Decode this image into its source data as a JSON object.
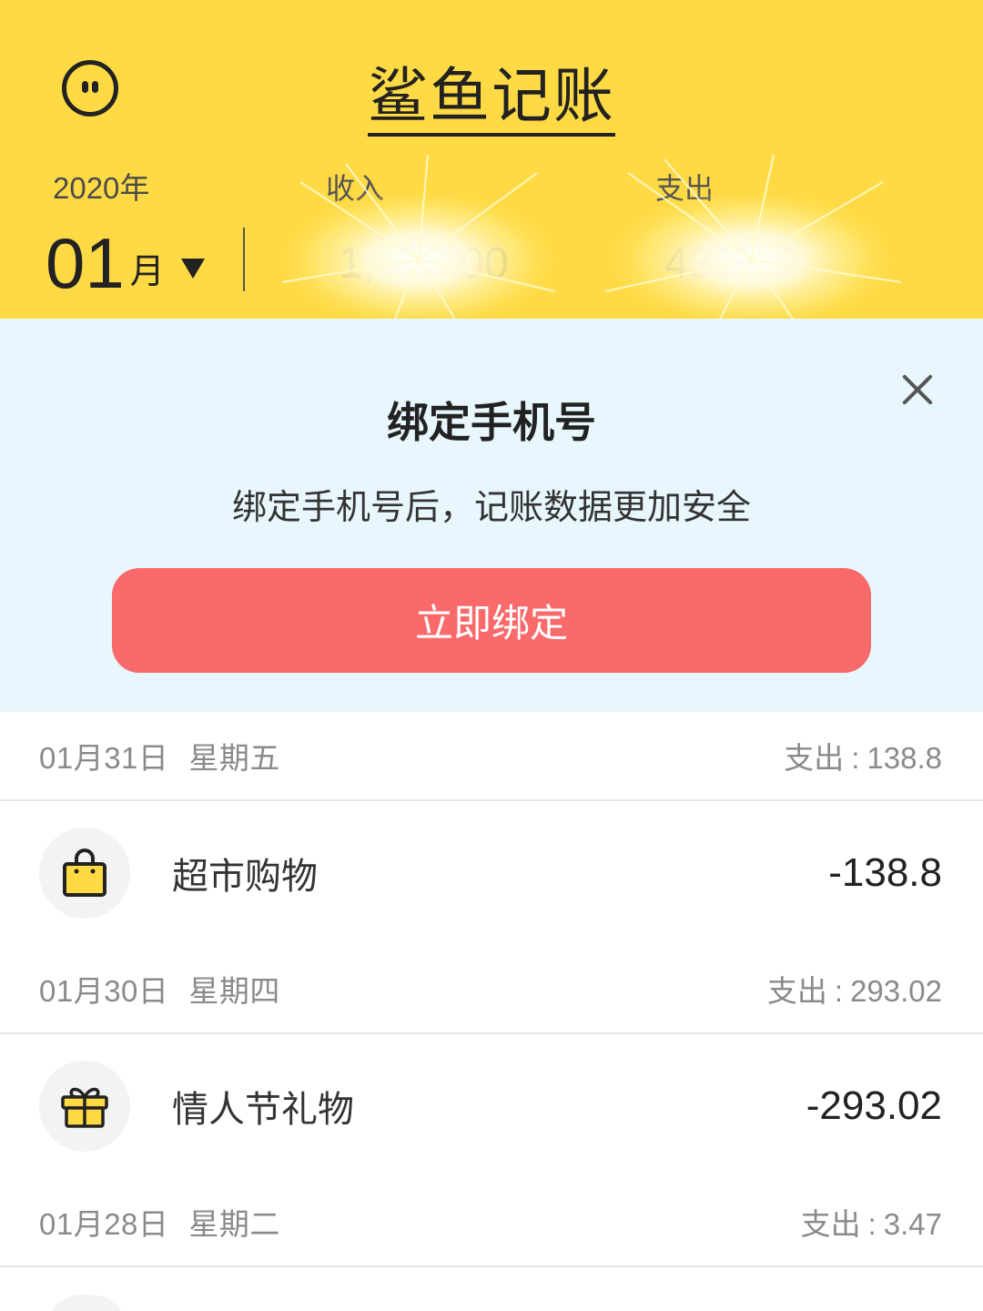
{
  "header": {
    "app_title": "鲨鱼记账",
    "year": "2020年",
    "month_number": "01",
    "month_unit": "月",
    "income_label": "收入",
    "income_value": "1,457.00",
    "expense_label": "支出",
    "expense_value": "432.29",
    "background_color": "#FFDA44"
  },
  "banner": {
    "title": "绑定手机号",
    "description": "绑定手机号后，记账数据更加安全",
    "button_label": "立即绑定",
    "button_color": "#FA6A6B",
    "background_color": "#E8F6FD"
  },
  "days": [
    {
      "date": "01月31日",
      "weekday": "星期五",
      "summary_label": "支出",
      "summary_value": "138.8",
      "records": [
        {
          "icon": "shopping-bag-icon",
          "name": "超市购物",
          "amount": "-138.8"
        }
      ]
    },
    {
      "date": "01月30日",
      "weekday": "星期四",
      "summary_label": "支出",
      "summary_value": "293.02",
      "records": [
        {
          "icon": "gift-icon",
          "name": "情人节礼物",
          "amount": "-293.02"
        }
      ]
    },
    {
      "date": "01月28日",
      "weekday": "星期二",
      "summary_label": "支出",
      "summary_value": "3.47",
      "records": []
    }
  ]
}
